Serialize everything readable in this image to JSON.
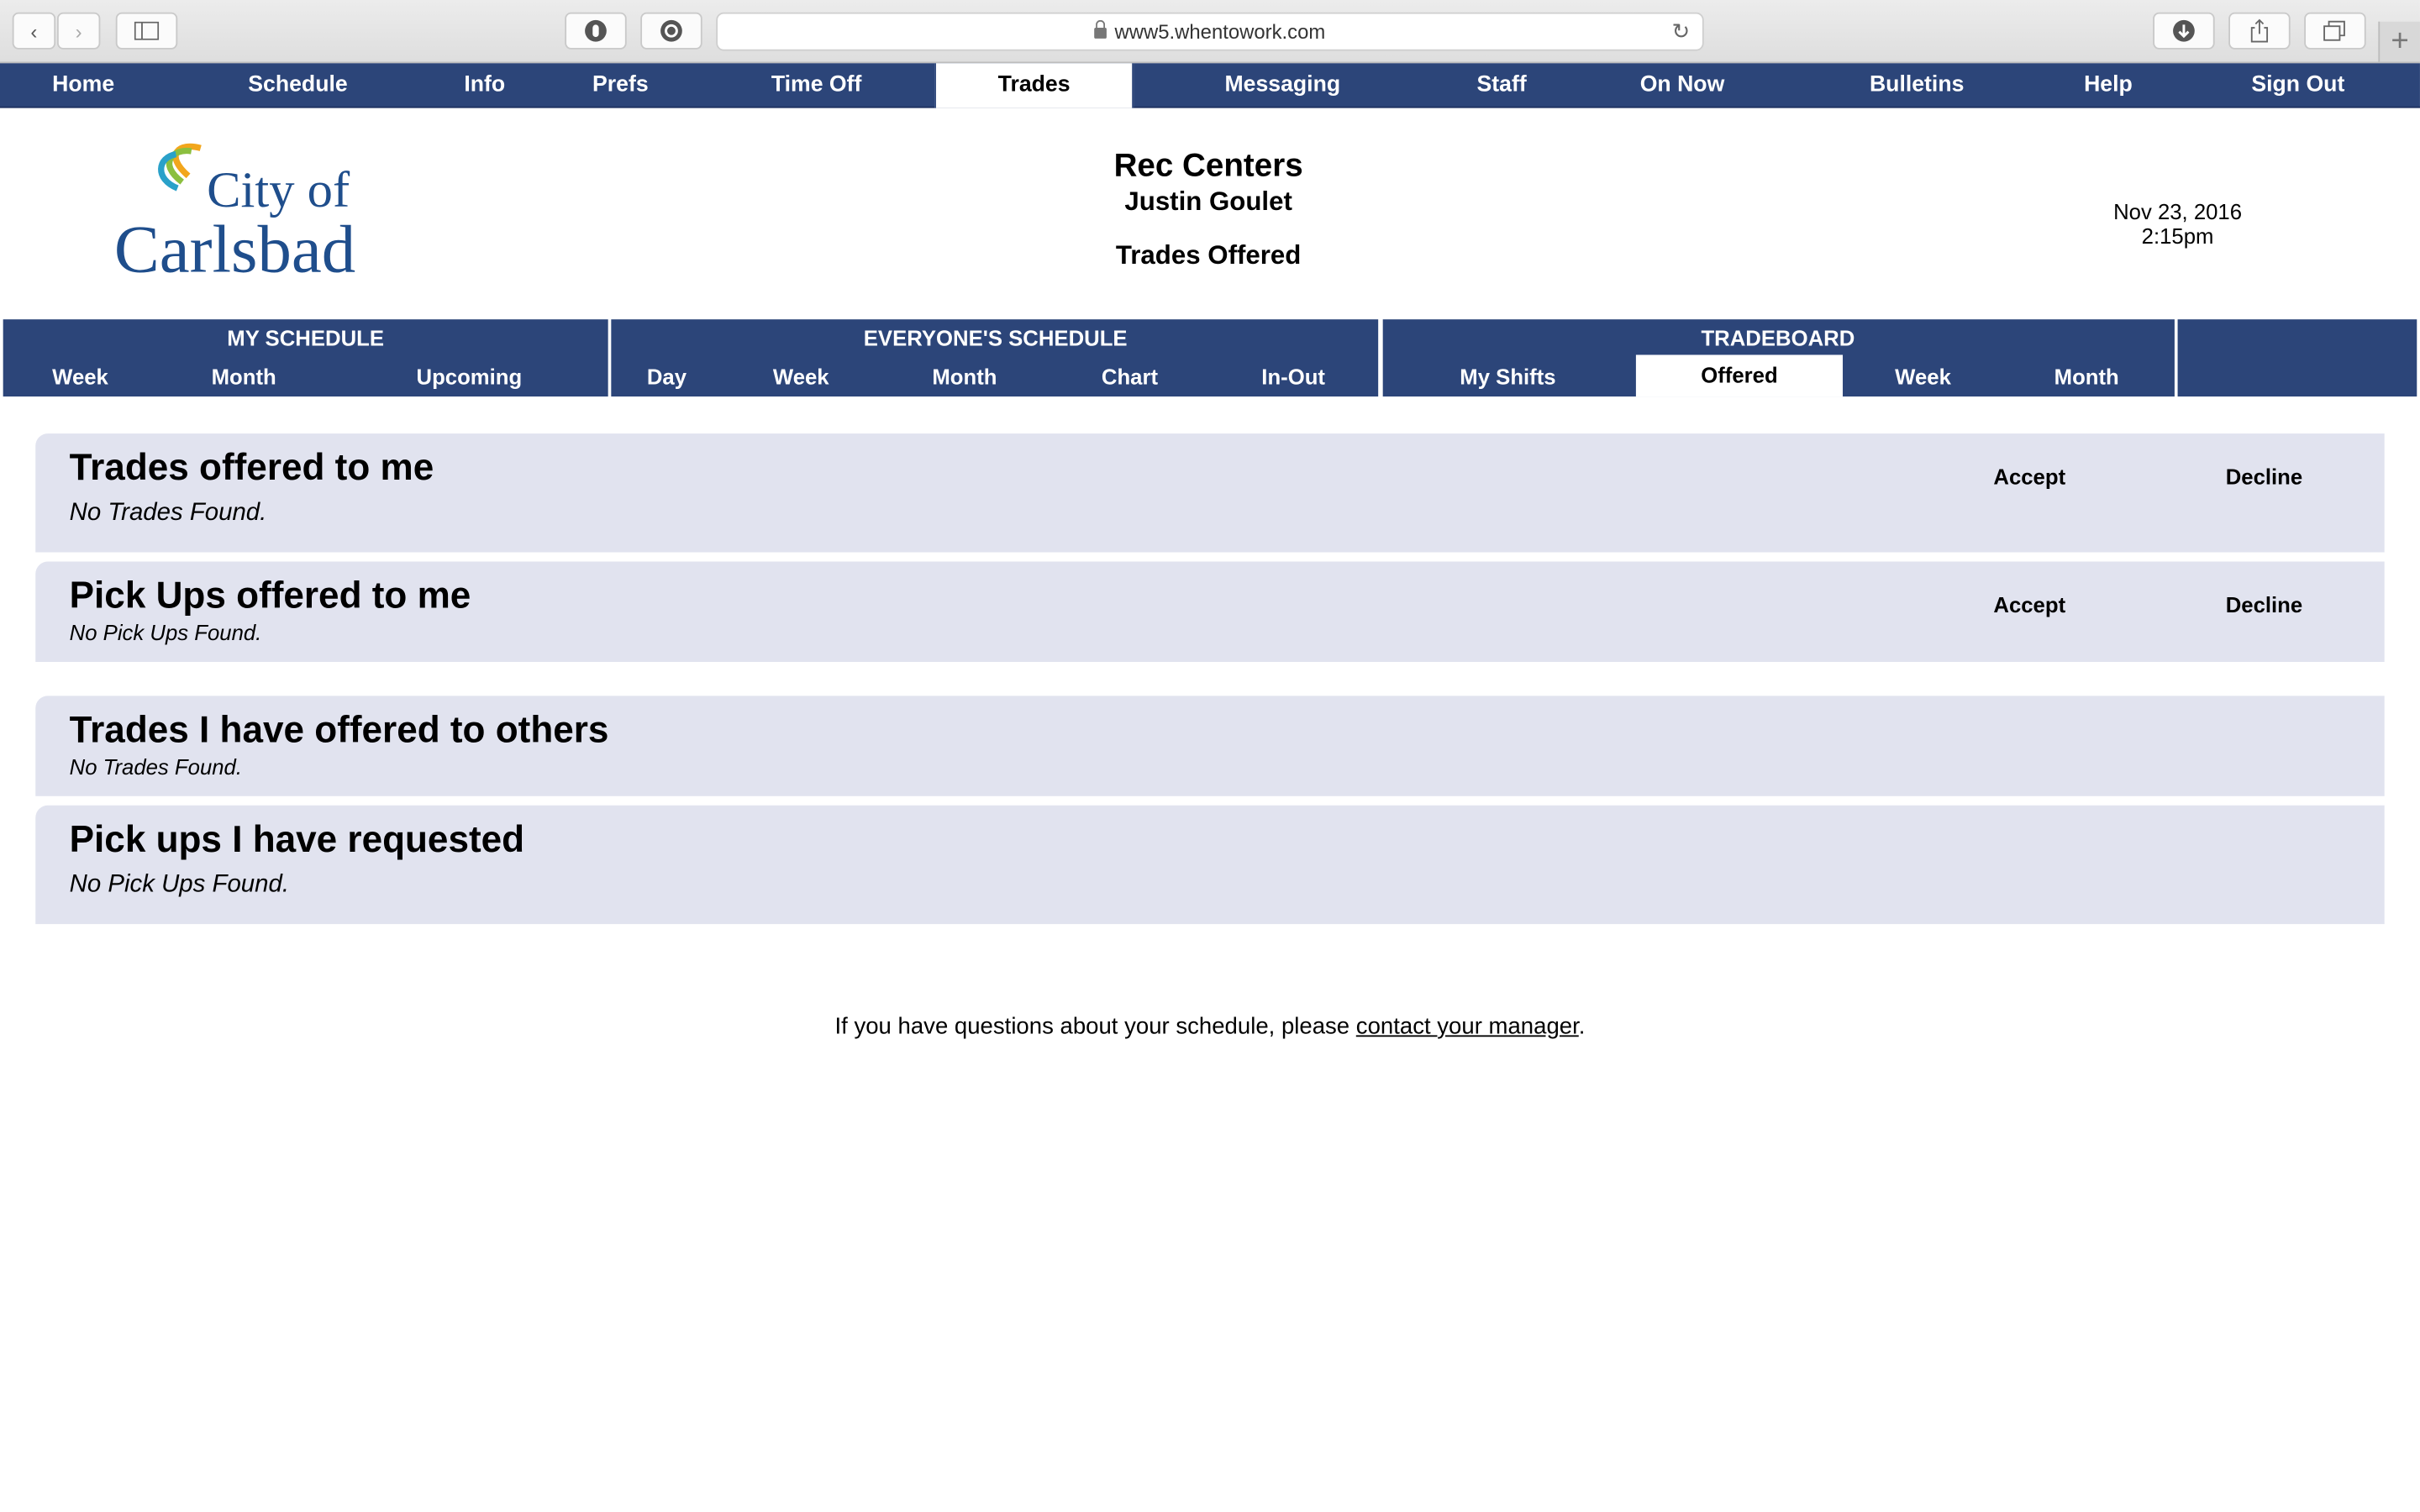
{
  "browser": {
    "url": "www5.whentowork.com",
    "icons": [
      "back-icon",
      "forward-icon",
      "sidebar-icon",
      "extension-icon",
      "grammarly-icon",
      "lock-icon",
      "reload-icon",
      "download-icon",
      "share-icon",
      "tabs-icon",
      "new-tab-icon"
    ]
  },
  "topnav": {
    "items": [
      "Home",
      "Schedule",
      "Info",
      "Prefs",
      "Time Off",
      "Trades",
      "Messaging",
      "Staff",
      "On Now",
      "Bulletins",
      "Help",
      "Sign Out"
    ],
    "active": "Trades"
  },
  "header": {
    "logo_text_line1": "City of",
    "logo_text_line2": "Carlsbad",
    "organization": "Rec Centers",
    "user": "Justin Goulet",
    "page_title": "Trades Offered",
    "date": "Nov 23, 2016",
    "time": "2:15pm"
  },
  "subnav": {
    "my_schedule": {
      "title": "MY SCHEDULE",
      "items": [
        "Week",
        "Month",
        "Upcoming"
      ]
    },
    "everyones_schedule": {
      "title": "EVERYONE'S SCHEDULE",
      "items": [
        "Day",
        "Week",
        "Month",
        "Chart",
        "In-Out"
      ]
    },
    "tradeboard": {
      "title": "TRADEBOARD",
      "items": [
        "My Shifts",
        "Offered",
        "Week",
        "Month"
      ],
      "active": "Offered"
    }
  },
  "sections": {
    "trades_offered_to_me": {
      "title": "Trades offered to me",
      "empty": "No Trades Found.",
      "accept": "Accept",
      "decline": "Decline"
    },
    "pickups_offered_to_me": {
      "title": "Pick Ups offered to me",
      "empty": "No Pick Ups Found.",
      "accept": "Accept",
      "decline": "Decline"
    },
    "trades_offered_to_others": {
      "title": "Trades I have offered to others",
      "empty": "No Trades Found."
    },
    "pickups_requested": {
      "title": "Pick ups I have requested",
      "empty": "No Pick Ups Found."
    }
  },
  "footer": {
    "text_before": "If you have questions about your schedule, please ",
    "link": "contact your manager",
    "text_after": "."
  },
  "colors": {
    "nav_blue": "#2c4579",
    "panel_bg": "#e1e3ef"
  }
}
